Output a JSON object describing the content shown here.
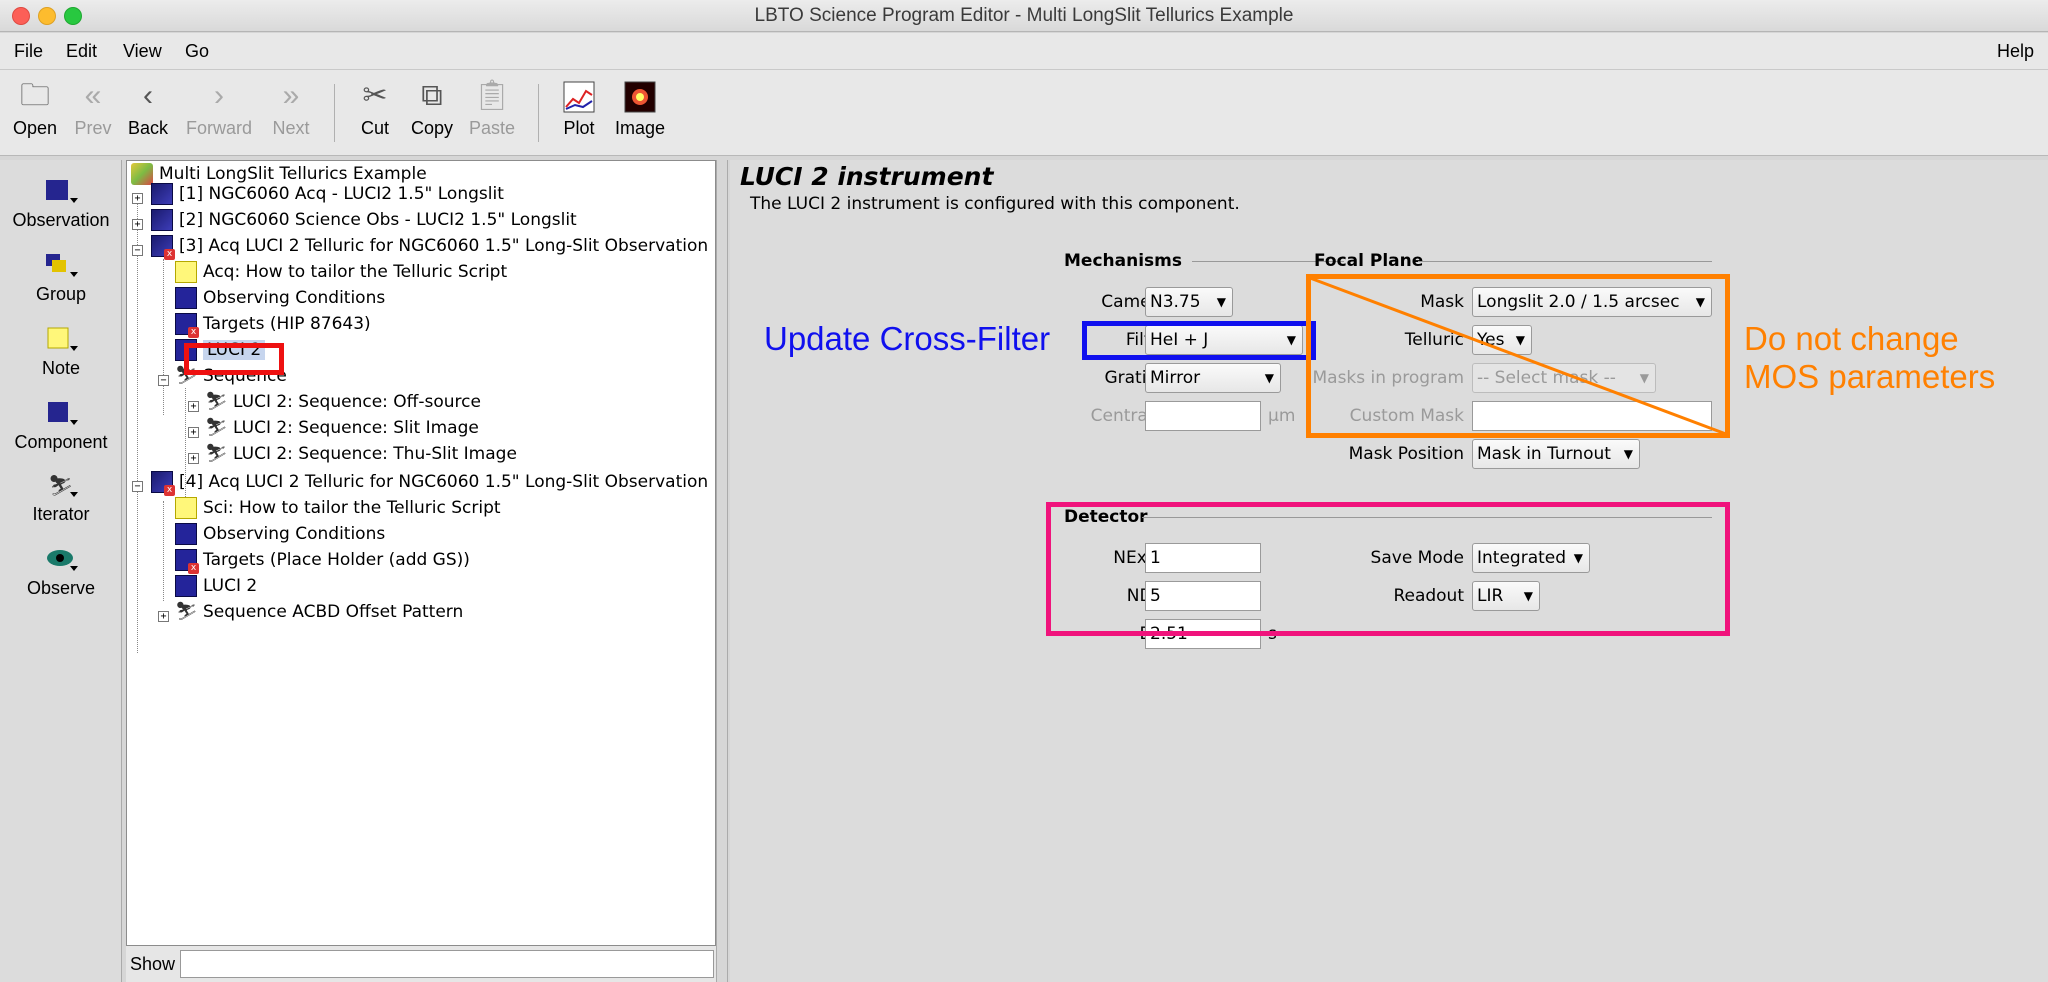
{
  "window": {
    "title": "LBTO Science Program Editor - Multi LongSlit Tellurics Example"
  },
  "menu": {
    "file": "File",
    "edit": "Edit",
    "view": "View",
    "go": "Go",
    "help": "Help"
  },
  "toolbar": {
    "open": "Open",
    "prev": "Prev",
    "back": "Back",
    "forward": "Forward",
    "next": "Next",
    "cut": "Cut",
    "copy": "Copy",
    "paste": "Paste",
    "plot": "Plot",
    "image": "Image"
  },
  "palette": {
    "observation": "Observation",
    "group": "Group",
    "note": "Note",
    "component": "Component",
    "iterator": "Iterator",
    "observe": "Observe"
  },
  "tree": {
    "root": "Multi LongSlit Tellurics Example",
    "n1": "[1] NGC6060 Acq - LUCI2 1.5\" Longslit",
    "n2": "[2] NGC6060 Science Obs - LUCI2 1.5\" Longslit",
    "n3": "[3] Acq LUCI 2 Telluric for NGC6060 1.5\" Long-Slit Observation",
    "n3_note": "Acq: How to tailor the Telluric Script",
    "n3_cond": "Observing Conditions",
    "n3_targets": "Targets (HIP 87643)",
    "n3_inst": "LUCI 2",
    "n3_seq": "Sequence",
    "n3_seq1": "LUCI 2: Sequence: Off-source",
    "n3_seq2": "LUCI 2: Sequence: Slit Image",
    "n3_seq3": "LUCI 2: Sequence: Thu-Slit Image",
    "n4": "[4] Acq LUCI 2 Telluric for NGC6060 1.5\" Long-Slit Observation",
    "n4_note": "Sci: How to tailor the Telluric Script",
    "n4_cond": "Observing Conditions",
    "n4_targets": "Targets (Place Holder (add GS))",
    "n4_inst": "LUCI 2",
    "n4_seq": "Sequence ACBD Offset Pattern",
    "show_label": "Show"
  },
  "panel": {
    "title": "LUCI 2 instrument",
    "description": "The LUCI 2 instrument is configured with this component.",
    "mechanisms": "Mechanisms",
    "focal_plane": "Focal Plane",
    "detector": "Detector",
    "camera_label": "Camera",
    "camera_value": "N3.75",
    "filter_label": "Filter",
    "filter_value": "HeI + J",
    "grating_label": "Grating",
    "grating_value": "Mirror",
    "central_label": "Central λ",
    "central_unit": "μm",
    "central_value": "",
    "mask_label": "Mask",
    "mask_value": "Longslit 2.0 / 1.5 arcsec",
    "telluric_label": "Telluric",
    "telluric_value": "Yes",
    "masks_in_program_label": "Masks in program",
    "masks_in_program_value": "-- Select mask --",
    "custom_mask_label": "Custom Mask",
    "custom_mask_value": "",
    "mask_position_label": "Mask Position",
    "mask_position_value": "Mask in Turnout",
    "nexpo_label": "NExpo",
    "nexpo_value": "1",
    "ndit_label": "NDIT",
    "ndit_value": "5",
    "dit_label": "DIT",
    "dit_value": "2.51",
    "dit_unit": "s",
    "save_mode_label": "Save Mode",
    "save_mode_value": "Integrated",
    "readout_label": "Readout",
    "readout_value": "LIR"
  },
  "annotations": {
    "update_filter": "Update Cross-Filter",
    "mos_line1": "Do not change",
    "mos_line2": "MOS parameters",
    "colors": {
      "blue": "#1010ee",
      "orange": "#ff8000",
      "pink": "#f0137c",
      "red": "#ee1111"
    }
  }
}
